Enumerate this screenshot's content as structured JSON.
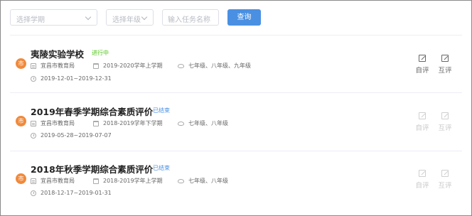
{
  "filters": {
    "semester_placeholder": "选择学期",
    "grade_placeholder": "选择年级",
    "task_name_placeholder": "输入任务名称",
    "query_label": "查询"
  },
  "tasks": [
    {
      "avatar": "市",
      "title": "夷陵实验学校",
      "status": "进行中",
      "status_type": "in-progress",
      "org": "宜昌市教育局",
      "semester": "2019-2020学年上学期",
      "grades": "七年级、八年级、九年级",
      "date_range": "2019-12-01~2019-12-31",
      "self_eval_label": "自评",
      "peer_eval_label": "互评",
      "actions_enabled": true
    },
    {
      "avatar": "市",
      "title": "2019年春季学期综合素质评价",
      "status": "已结束",
      "status_type": "ended",
      "org": "宜昌市教育局",
      "semester": "2018-2019学年下学期",
      "grades": "七年级、八年级",
      "date_range": "2019-05-28~2019-07-07",
      "self_eval_label": "自评",
      "peer_eval_label": "互评",
      "actions_enabled": false
    },
    {
      "avatar": "市",
      "title": "2018年秋季学期综合素质评价",
      "status": "已结束",
      "status_type": "ended",
      "org": "宜昌市教育局",
      "semester": "2018-2019学年上学期",
      "grades": "七年级、八年级",
      "date_range": "2018-12-17~2019-01-31",
      "self_eval_label": "自评",
      "peer_eval_label": "互评",
      "actions_enabled": false
    }
  ],
  "colors": {
    "primary": "#4a90e2",
    "in_progress": "#52c41a",
    "avatar": "#f08a3c"
  },
  "icons": [
    "chevron-down-icon",
    "document-icon",
    "calendar-icon",
    "grade-icon",
    "clock-icon",
    "edit-icon"
  ]
}
